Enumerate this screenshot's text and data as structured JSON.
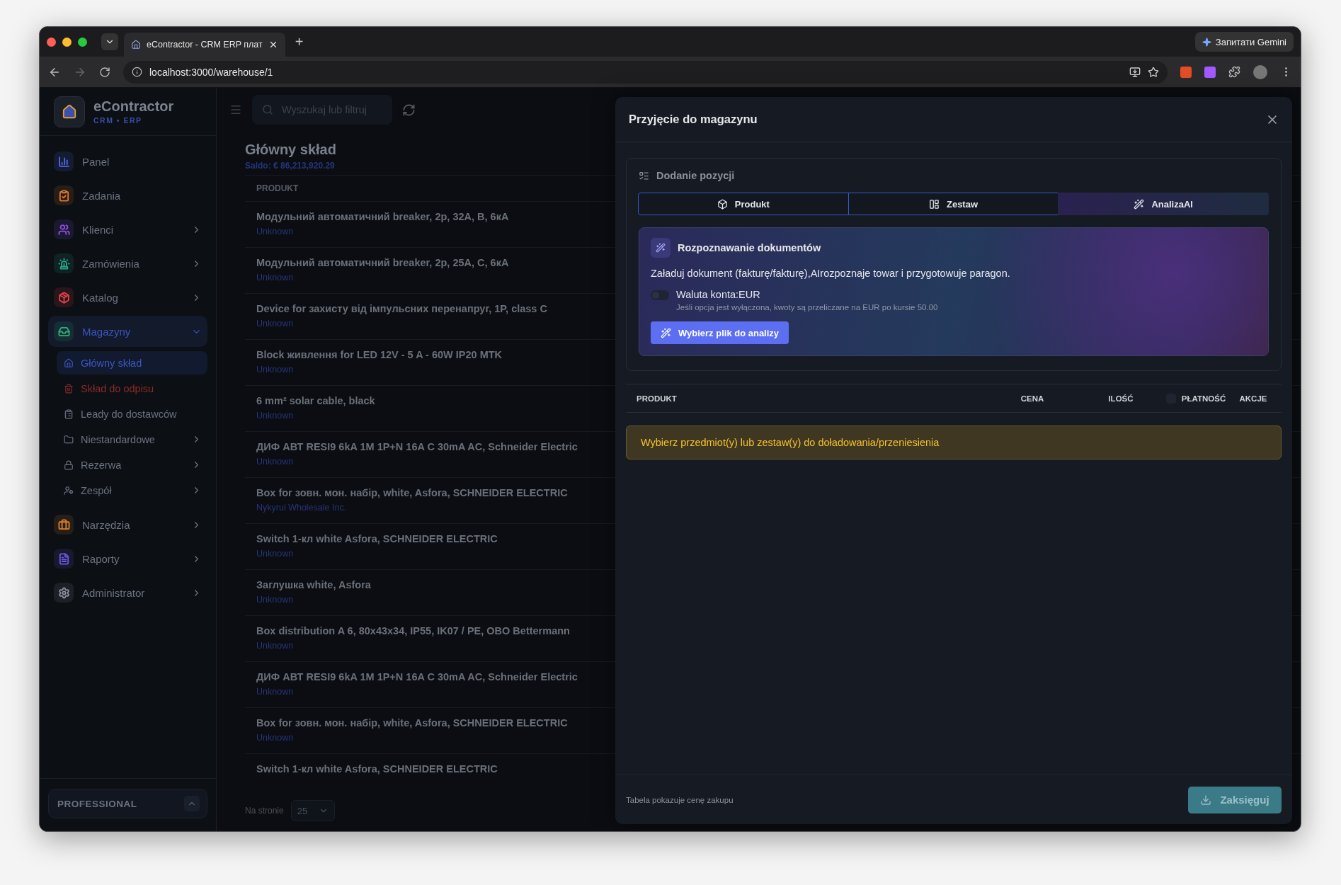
{
  "browser": {
    "tabs": [
      {
        "title": "eContractor - CRM ERP плат",
        "selected": true
      }
    ],
    "new_tab": "+",
    "url": "localhost:3000/warehouse/1",
    "assistant_button": "Запитати Gemini"
  },
  "sidebar": {
    "brand": {
      "name": "eContractor",
      "subtitle": "CRM • ERP"
    },
    "items": [
      {
        "label": "Panel",
        "color": "#4f6bed",
        "expandable": false,
        "expanded": false,
        "selected": false
      },
      {
        "label": "Zadania",
        "color": "#e07a2e",
        "expandable": false,
        "expanded": false,
        "selected": false
      },
      {
        "label": "Klienci",
        "color": "#8a4fe0",
        "expandable": true,
        "expanded": false,
        "selected": false
      },
      {
        "label": "Zamówienia",
        "color": "#2aa58a",
        "expandable": true,
        "expanded": false,
        "selected": false
      },
      {
        "label": "Katalog",
        "color": "#e0404a",
        "expandable": true,
        "expanded": false,
        "selected": false
      },
      {
        "label": "Magazyny",
        "color": "#2fae7a",
        "expandable": true,
        "expanded": true,
        "selected": true,
        "children": [
          {
            "label": "Główny skład",
            "kind": "normal",
            "expandable": false,
            "selected": true
          },
          {
            "label": "Skład do odpisu",
            "kind": "danger",
            "expandable": false,
            "selected": false
          },
          {
            "label": "Leady do dostawców",
            "kind": "normal",
            "expandable": false,
            "selected": false
          },
          {
            "label": "Niestandardowe",
            "kind": "normal",
            "expandable": true,
            "selected": false
          },
          {
            "label": "Rezerwa",
            "kind": "normal",
            "expandable": true,
            "selected": false
          },
          {
            "label": "Zespół",
            "kind": "normal",
            "expandable": true,
            "selected": false
          }
        ]
      },
      {
        "label": "Narzędzia",
        "color": "#d9822b",
        "expandable": true,
        "expanded": false,
        "selected": false
      },
      {
        "label": "Raporty",
        "color": "#6a5ae0",
        "expandable": true,
        "expanded": false,
        "selected": false
      },
      {
        "label": "Administrator",
        "color": "#8b93a1",
        "expandable": true,
        "expanded": false,
        "selected": false
      }
    ],
    "plan": "PROFESSIONAL"
  },
  "warehouse": {
    "search": {
      "placeholder": "Wyszukaj lub filtruj"
    },
    "title": "Główny skład",
    "balance": "Saldo: € 86,213,920.29",
    "column": "PRODUKT",
    "rows": [
      {
        "name": "Модульний автоматичний breaker, 2p, 32A, B, 6кА",
        "supplier": "Unknown"
      },
      {
        "name": "Модульний автоматичний breaker, 2p, 25A, C, 6кА",
        "supplier": "Unknown"
      },
      {
        "name": "Device for захисту від імпульсних перенапруг, 1P, class C",
        "supplier": "Unknown"
      },
      {
        "name": "Block живлення for LED 12V - 5 A - 60W IP20 MTK",
        "supplier": "Unknown"
      },
      {
        "name": "6 mm² solar cable, black",
        "supplier": "Unknown"
      },
      {
        "name": "ДИФ АВТ RESI9 6kA 1M 1P+N 16A C 30mA AC, Schneider Electric",
        "supplier": "Unknown"
      },
      {
        "name": "Box for зовн. мон. набір, white, Asfora, SCHNEIDER ELECTRIC",
        "supplier": "Nykyrui Wholesale Inc."
      },
      {
        "name": "Switch 1-кл white Asfora, SCHNEIDER ELECTRIC",
        "supplier": "Unknown"
      },
      {
        "name": "Заглушка white, Asfora",
        "supplier": "Unknown"
      },
      {
        "name": "Box distribution A 6, 80x43x34, IP55, IK07 / PE, OBO Bettermann",
        "supplier": "Unknown"
      },
      {
        "name": "ДИФ АВТ RESI9 6kA 1M 1P+N 16A C 30mA AC, Schneider Electric",
        "supplier": "Unknown"
      },
      {
        "name": "Box for зовн. мон. набір, white, Asfora, SCHNEIDER ELECTRIC",
        "supplier": "Unknown"
      },
      {
        "name": "Switch 1-кл white Asfora, SCHNEIDER ELECTRIC"
      }
    ],
    "pagination": {
      "label": "Na stronie",
      "value": "25"
    }
  },
  "modal": {
    "title": "Przyjęcie do magazynu",
    "section_title": "Dodanie pozycji",
    "tabs": [
      {
        "label": "Produkt",
        "selected": false
      },
      {
        "label": "Zestaw",
        "selected": false
      },
      {
        "label": "AnalizaAI",
        "selected": true
      }
    ],
    "ai_card": {
      "title": "Rozpoznawanie dokumentów",
      "description": "Załaduj dokument (fakturę/fakturę),AIrozpoznaje towar i przygotowuje paragon.",
      "toggle": {
        "label": "Waluta konta:EUR",
        "hint": "Jeśli opcja jest wyłączona, kwoty są przeliczane na EUR po kursie 50.00",
        "on": false
      },
      "button": "Wybierz plik do analizy"
    },
    "columns": [
      {
        "label": "PRODUKT"
      },
      {
        "label": "CENA"
      },
      {
        "label": "ILOŚĆ"
      },
      {
        "label": "PŁATNOŚĆ",
        "checkbox": true,
        "checked": false
      },
      {
        "label": "AKCJE"
      }
    ],
    "alert": "Wybierz przedmiot(y) lub zestaw(y) do doładowania/przeniesienia",
    "footer_note": "Tabela pokazuje cenę zakupu",
    "submit": {
      "label": "Zaksięguj",
      "disabled": true
    }
  }
}
